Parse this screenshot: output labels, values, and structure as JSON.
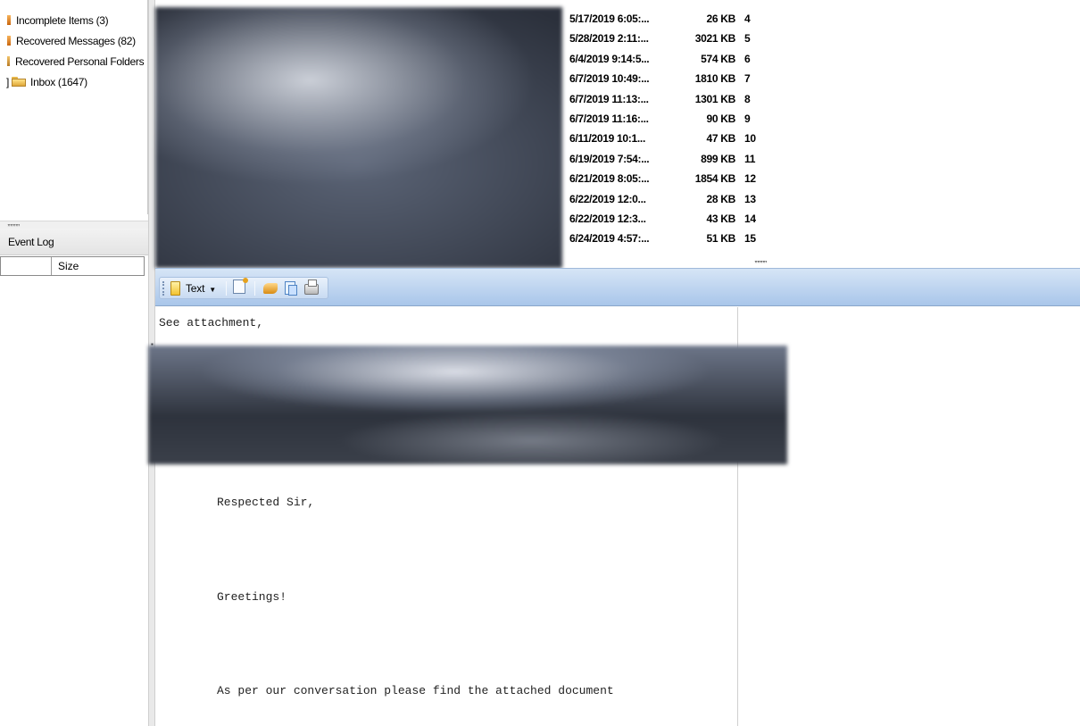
{
  "folder_tree": {
    "items": [
      {
        "label": "Incomplete Items (3)"
      },
      {
        "label": "Recovered Messages (82)"
      },
      {
        "label": "Recovered Personal Folders"
      },
      {
        "label": "Inbox (1647)"
      }
    ]
  },
  "event_log": {
    "title": "Event Log",
    "columns": [
      "",
      "Size"
    ]
  },
  "message_list": {
    "rows": [
      {
        "date": "5/17/2019 6:05:...",
        "size": "26 KB",
        "num": "4"
      },
      {
        "date": "5/28/2019 2:11:...",
        "size": "3021 KB",
        "num": "5"
      },
      {
        "date": "6/4/2019 9:14:5...",
        "size": "574 KB",
        "num": "6"
      },
      {
        "date": "6/7/2019 10:49:...",
        "size": "1810 KB",
        "num": "7"
      },
      {
        "date": "6/7/2019 11:13:...",
        "size": "1301 KB",
        "num": "8"
      },
      {
        "date": "6/7/2019 11:16:...",
        "size": "90 KB",
        "num": "9"
      },
      {
        "date": "6/11/2019 10:1...",
        "size": "47 KB",
        "num": "10"
      },
      {
        "date": "6/19/2019 7:54:...",
        "size": "899 KB",
        "num": "11"
      },
      {
        "date": "6/21/2019 8:05:...",
        "size": "1854 KB",
        "num": "12"
      },
      {
        "date": "6/22/2019 12:0...",
        "size": "28 KB",
        "num": "13"
      },
      {
        "date": "6/22/2019 12:3...",
        "size": "43 KB",
        "num": "14"
      },
      {
        "date": "6/24/2019 4:57:...",
        "size": "51 KB",
        "num": "15"
      }
    ]
  },
  "toolbar": {
    "text_label": "Text",
    "icons": [
      "note-icon",
      "properties-icon",
      "reply-icon",
      "copy-icon",
      "print-icon"
    ]
  },
  "message": {
    "line1": "See attachment,",
    "salutation": "Respected Sir,",
    "greeting": "Greetings!",
    "body": "As per our conversation please find the attached document"
  },
  "colors": {
    "toolbar_top": "#d6e5f6",
    "toolbar_bottom": "#a9c6ea",
    "folder_orange": "#e07a1c"
  }
}
